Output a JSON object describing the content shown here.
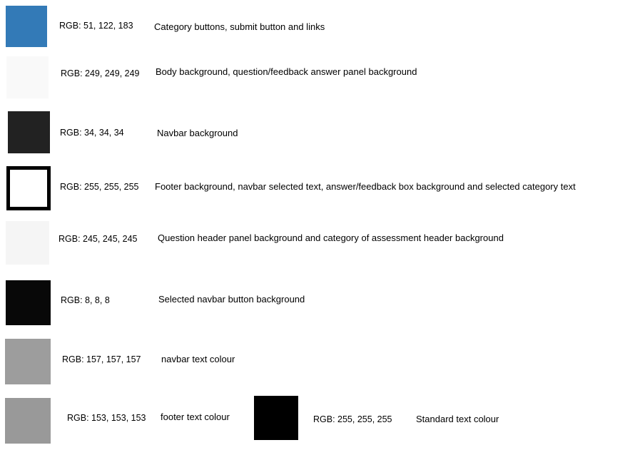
{
  "rows": [
    {
      "color": "#337ab7",
      "rgb": "RGB: 51, 122, 183",
      "desc": "Category buttons, submit button and links"
    },
    {
      "color": "#f9f9f9",
      "rgb": "RGB: 249, 249, 249",
      "desc": "Body background, question/feedback answer panel background"
    },
    {
      "color": "#222222",
      "rgb": "RGB: 34, 34, 34",
      "desc": "Navbar background"
    },
    {
      "color": "#ffffff",
      "rgb": "RGB: 255, 255, 255",
      "desc": "Footer background, navbar selected text, answer/feedback box background and selected category text"
    },
    {
      "color": "#f5f5f5",
      "rgb": "RGB: 245, 245, 245",
      "desc": "Question header panel background and category of assessment header background"
    },
    {
      "color": "#080808",
      "rgb": "RGB: 8, 8, 8",
      "desc": "Selected navbar button background"
    },
    {
      "color": "#9d9d9d",
      "rgb": "RGB: 157, 157, 157",
      "desc": "navbar text colour"
    },
    {
      "color": "#999999",
      "rgb": "RGB: 153, 153, 153",
      "desc": "footer text colour"
    },
    {
      "color": "#000000",
      "rgb": "RGB: 255, 255, 255",
      "desc": "Standard text colour"
    }
  ]
}
